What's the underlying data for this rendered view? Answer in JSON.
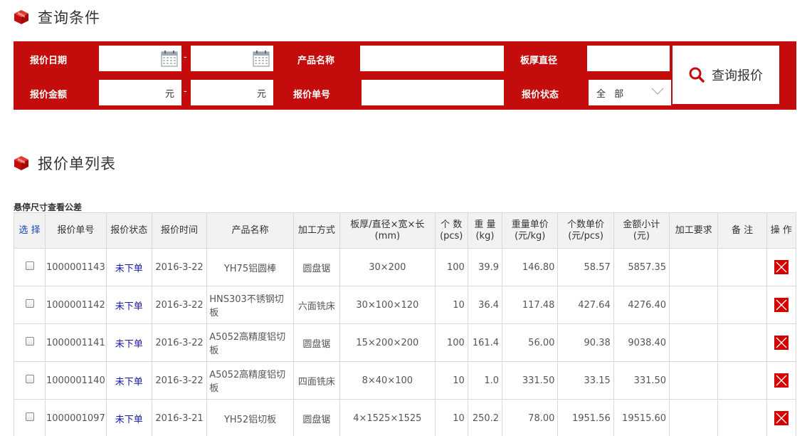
{
  "query": {
    "title": "查询条件",
    "labels": {
      "date": "报价日期",
      "product": "产品名称",
      "thickness": "板厚直径",
      "amount": "报价金额",
      "number": "报价单号",
      "status": "报价状态"
    },
    "dash": "-",
    "unit": "元",
    "status_value": "全 部",
    "search_label": "查询报价"
  },
  "list": {
    "title": "报价单列表",
    "hint": "悬停尺寸查看公差",
    "headers": {
      "select": "选 择",
      "number": "报价单号",
      "status": "报价状态",
      "time": "报价时间",
      "product": "产品名称",
      "process": "加工方式",
      "size_1": "板厚/直径×宽×长",
      "size_2": "(mm)",
      "qty_1": "个 数",
      "qty_2": "(pcs)",
      "weight_1": "重 量",
      "weight_2": "(kg)",
      "wprice_1": "重量单价",
      "wprice_2": "(元/kg)",
      "uprice_1": "个数单价",
      "uprice_2": "(元/pcs)",
      "subtotal_1": "金额小计",
      "subtotal_2": "(元)",
      "requirement": "加工要求",
      "note": "备 注",
      "action": "操 作"
    },
    "rows": [
      {
        "number": "1000001143",
        "status": "未下单",
        "time": "2016-3-22",
        "product": "YH75铝圆棒",
        "process": "圆盘锯",
        "size": "30×200",
        "qty": "100",
        "weight": "39.9",
        "wprice": "146.80",
        "uprice": "58.57",
        "subtotal": "5857.35"
      },
      {
        "number": "1000001142",
        "status": "未下单",
        "time": "2016-3-22",
        "product": "HNS303不锈钢切板",
        "process": "六面铣床",
        "size": "30×100×120",
        "qty": "10",
        "weight": "36.4",
        "wprice": "117.48",
        "uprice": "427.64",
        "subtotal": "4276.40"
      },
      {
        "number": "1000001141",
        "status": "未下单",
        "time": "2016-3-22",
        "product": "A5052高精度铝切板",
        "process": "圆盘锯",
        "size": "15×200×200",
        "qty": "100",
        "weight": "161.4",
        "wprice": "56.00",
        "uprice": "90.38",
        "subtotal": "9038.40"
      },
      {
        "number": "1000001140",
        "status": "未下单",
        "time": "2016-3-22",
        "product": "A5052高精度铝切板",
        "process": "四面铣床",
        "size": "8×40×100",
        "qty": "10",
        "weight": "1.0",
        "wprice": "331.50",
        "uprice": "33.15",
        "subtotal": "331.50"
      },
      {
        "number": "1000001097",
        "status": "未下单",
        "time": "2016-3-21",
        "product": "YH52铝切板",
        "process": "圆盘锯",
        "size": "4×1525×1525",
        "qty": "10",
        "weight": "250.2",
        "wprice": "78.00",
        "uprice": "1951.56",
        "subtotal": "19515.60"
      }
    ]
  },
  "colors": {
    "brand_red": "#c40c0c",
    "status_blue": "#1a1aa8",
    "select_blue": "#1a44b6"
  },
  "icons": {
    "section": "cube-icon",
    "calendar": "calendar-icon",
    "search": "search-icon",
    "dropdown": "chevron-down-icon",
    "delete": "delete-icon"
  }
}
